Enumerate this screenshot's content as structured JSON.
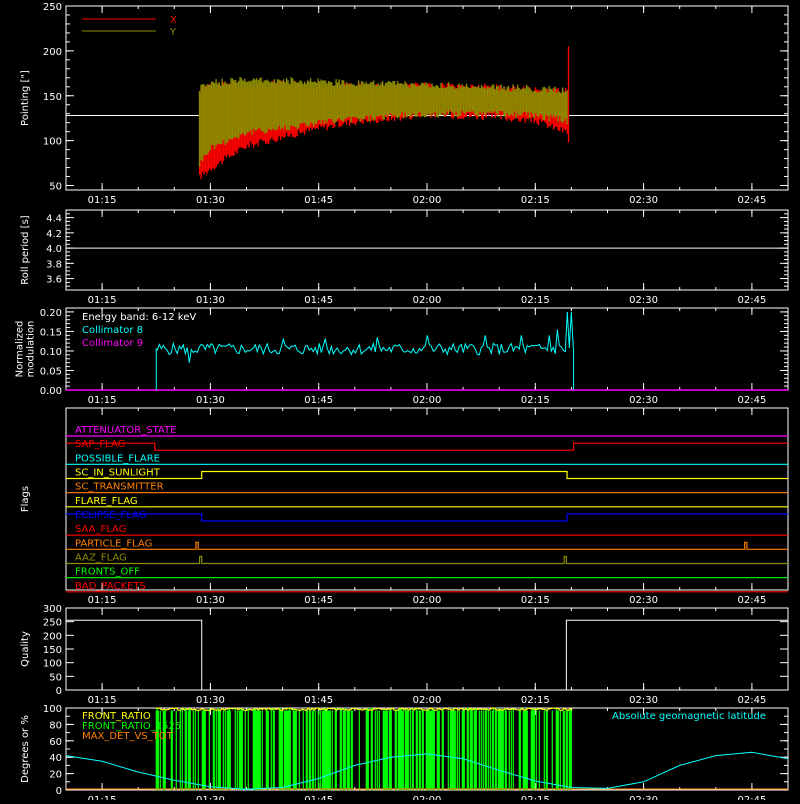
{
  "time_axis": {
    "tick_labels": [
      "01:15",
      "01:30",
      "01:45",
      "02:00",
      "02:15",
      "02:30",
      "02:45"
    ],
    "tick_minutes": [
      75,
      90,
      105,
      120,
      135,
      150,
      165
    ],
    "range_minutes": [
      70,
      170
    ]
  },
  "chart_data": [
    {
      "id": "pointing",
      "type": "line",
      "ylabel": "Pointing [\"]",
      "ylim": [
        45,
        250
      ],
      "yticks": [
        50,
        100,
        150,
        200,
        250
      ],
      "legend_position": "top-left",
      "series": [
        {
          "name": "X",
          "color": "#ff0000",
          "band": [
            [
              88.5,
              55,
              160
            ],
            [
              90,
              65,
              165
            ],
            [
              95,
              90,
              166
            ],
            [
              100,
              100,
              167
            ],
            [
              105,
              110,
              165
            ],
            [
              110,
              117,
              165
            ],
            [
              115,
              121,
              164
            ],
            [
              120,
              125,
              165
            ],
            [
              125,
              124,
              164
            ],
            [
              130,
              122,
              163
            ],
            [
              135,
              118,
              160
            ],
            [
              139.5,
              105,
              160
            ]
          ]
        },
        {
          "name": "Y",
          "color": "#8b8b00",
          "band": [
            [
              88.5,
              70,
              162
            ],
            [
              90,
              88,
              168
            ],
            [
              95,
              105,
              172
            ],
            [
              100,
              110,
              171
            ],
            [
              105,
              116,
              170
            ],
            [
              110,
              120,
              168
            ],
            [
              115,
              123,
              167
            ],
            [
              120,
              125,
              166
            ],
            [
              125,
              126,
              165
            ],
            [
              130,
              126,
              163
            ],
            [
              135,
              124,
              162
            ],
            [
              139.5,
              118,
              160
            ]
          ]
        }
      ],
      "reference_line": {
        "value": 128,
        "color": "#ffffff"
      },
      "spike": {
        "x": 139.6,
        "y1": 98,
        "y2": 205,
        "color": "#ff0000"
      }
    },
    {
      "id": "roll",
      "type": "line",
      "ylabel": "Roll period [s]",
      "ylim": [
        3.45,
        4.5
      ],
      "yticks": [
        3.6,
        3.8,
        4.0,
        4.2,
        4.4
      ],
      "ytick_labels": [
        "3.6",
        "3.8",
        "4.0",
        "4.2",
        "4.4"
      ],
      "series": [
        {
          "name": "",
          "color": "#ffffff",
          "x": [
            70,
            170
          ],
          "y": [
            4.0,
            4.0
          ]
        }
      ]
    },
    {
      "id": "modulation",
      "type": "line",
      "ylabel": "Normalized modulation",
      "ylabel_lines": [
        "Normalized",
        "modulation"
      ],
      "ylim": [
        0,
        0.21
      ],
      "yticks": [
        0.0,
        0.05,
        0.1,
        0.15,
        0.2
      ],
      "ytick_labels": [
        "0.00",
        "0.05",
        "0.10",
        "0.15",
        "0.20"
      ],
      "annotation": "Energy band: 6-12 keV",
      "series": [
        {
          "name": "Collimator 8",
          "color": "#00ffff",
          "start": 82.5,
          "end": 140.3,
          "level": 0.105,
          "noise": 0.015,
          "spikes": [
            [
              87,
              0.07
            ],
            [
              100,
              0.13
            ],
            [
              106,
              0.13
            ],
            [
              113,
              0.135
            ],
            [
              120,
              0.14
            ],
            [
              128,
              0.14
            ],
            [
              133,
              0.14
            ],
            [
              137,
              0.14
            ],
            [
              138,
              0.155
            ],
            [
              139.5,
              0.2
            ],
            [
              140,
              0.2
            ]
          ]
        },
        {
          "name": "Collimator 9",
          "color": "#ff00ff",
          "level": 0.0
        }
      ]
    },
    {
      "id": "flags",
      "type": "line",
      "ylabel": "Flags",
      "rows": [
        {
          "name": "ATTENUATOR_STATE",
          "color": "#ff00ff",
          "steps": []
        },
        {
          "name": "SAP_FLAG",
          "color": "#ff0000",
          "steps": [
            [
              70,
              1
            ],
            [
              82.3,
              0
            ],
            [
              140.3,
              1
            ]
          ]
        },
        {
          "name": "POSSIBLE_FLARE",
          "color": "#00ffff",
          "steps": []
        },
        {
          "name": "SC_IN_SUNLIGHT",
          "color": "#ffff00",
          "steps": [
            [
              70,
              0
            ],
            [
              88.8,
              1
            ],
            [
              139.4,
              0
            ]
          ]
        },
        {
          "name": "SC_TRANSMITTER",
          "color": "#ff7f00",
          "steps": []
        },
        {
          "name": "FLARE_FLAG",
          "color": "#ffff00",
          "steps": []
        },
        {
          "name": "ECLIPSE_FLAG",
          "color": "#0000ff",
          "steps": [
            [
              70,
              1
            ],
            [
              88.8,
              0
            ],
            [
              139.4,
              1
            ]
          ]
        },
        {
          "name": "SAA_FLAG",
          "color": "#ff0000",
          "steps": []
        },
        {
          "name": "PARTICLE_FLAG",
          "color": "#ff7f00",
          "steps": [
            [
              70,
              0
            ],
            [
              88,
              1
            ],
            [
              88.3,
              0
            ],
            [
              164,
              1
            ],
            [
              164.3,
              0
            ]
          ]
        },
        {
          "name": "AAZ_FLAG",
          "color": "#8b8b00",
          "steps": [
            [
              70,
              0
            ],
            [
              88.5,
              1
            ],
            [
              88.8,
              0
            ],
            [
              139,
              1
            ],
            [
              139.3,
              0
            ]
          ]
        },
        {
          "name": "FRONTS_OFF",
          "color": "#00ff00",
          "steps": []
        },
        {
          "name": "BAD_PACKETS",
          "color": "#ff0000",
          "steps": []
        }
      ]
    },
    {
      "id": "quality",
      "type": "line",
      "ylabel": "Quality",
      "ylim": [
        0,
        300
      ],
      "yticks": [
        0,
        50,
        100,
        150,
        200,
        250,
        300
      ],
      "series": [
        {
          "name": "",
          "color": "#ffffff",
          "x": [
            70,
            88.8,
            88.8,
            139.3,
            139.3,
            170
          ],
          "y": [
            255,
            255,
            0,
            0,
            255,
            255
          ]
        }
      ]
    },
    {
      "id": "geomag",
      "type": "line",
      "ylabel": "Degrees or %",
      "ylim": [
        0,
        100
      ],
      "yticks": [
        0,
        20,
        40,
        60,
        80,
        100
      ],
      "legend_position": "top-left",
      "series": [
        {
          "name": "FRONT_RATIO",
          "color": "#ffff00"
        },
        {
          "name": "FRONT_RATIO_1525",
          "color": "#00ff00",
          "start": 82.5,
          "end": 140.3
        },
        {
          "name": "MAX_DET_VS_TOT",
          "color": "#ff7f00"
        },
        {
          "name": "Absolute geomagnetic latitude",
          "color": "#00ffff",
          "x": [
            70,
            75,
            80,
            85,
            90,
            95,
            100,
            105,
            110,
            115,
            120,
            125,
            130,
            135,
            140,
            145,
            150,
            155,
            160,
            165,
            170
          ],
          "y": [
            42,
            35,
            22,
            12,
            4,
            1,
            3,
            14,
            30,
            40,
            44,
            38,
            24,
            11,
            3,
            2,
            10,
            30,
            42,
            46,
            38
          ]
        }
      ]
    }
  ]
}
